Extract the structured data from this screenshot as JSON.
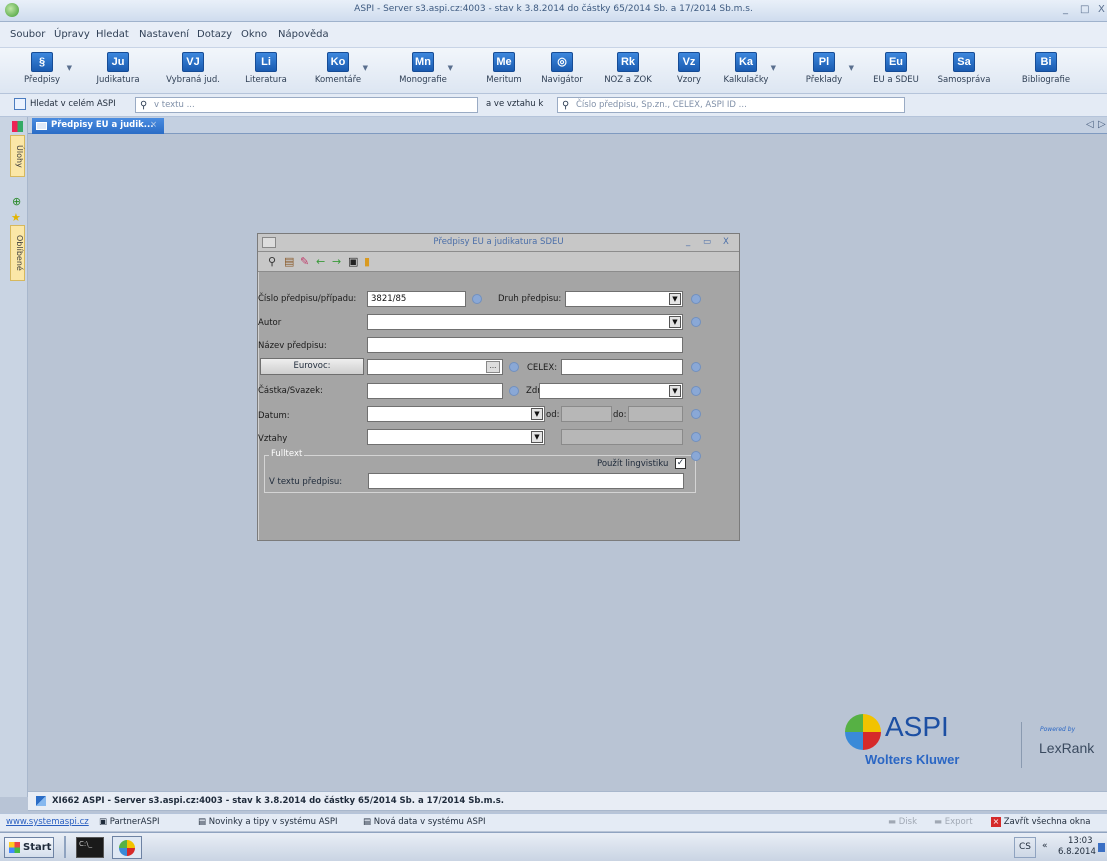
{
  "window": {
    "title": "ASPI - Server s3.aspi.cz:4003 - stav k 3.8.2014 do částky 65/2014 Sb. a 17/2014 Sb.m.s.",
    "controls": [
      "_",
      "□",
      "X"
    ]
  },
  "menu": [
    "Soubor",
    "Úpravy",
    "Hledat",
    "Nastavení",
    "Dotazy",
    "Okno",
    "Nápověda"
  ],
  "toolbar": [
    {
      "abbr": "§",
      "label": "Předpisy",
      "dropdown": true
    },
    {
      "abbr": "Ju",
      "label": "Judikatura",
      "dropdown": false
    },
    {
      "abbr": "VJ",
      "label": "Vybraná jud.",
      "dropdown": false
    },
    {
      "abbr": "Li",
      "label": "Literatura",
      "dropdown": false
    },
    {
      "abbr": "Ko",
      "label": "Komentáře",
      "dropdown": true
    },
    {
      "abbr": "Mn",
      "label": "Monografie",
      "dropdown": true
    },
    {
      "abbr": "Me",
      "label": "Meritum",
      "dropdown": false
    },
    {
      "abbr": "◎",
      "label": "Navigátor",
      "dropdown": false
    },
    {
      "abbr": "Rk",
      "label": "NOZ a ZOK",
      "dropdown": false
    },
    {
      "abbr": "Vz",
      "label": "Vzory",
      "dropdown": false
    },
    {
      "abbr": "Ka",
      "label": "Kalkulačky",
      "dropdown": true
    },
    {
      "abbr": "Pl",
      "label": "Překlady",
      "dropdown": true
    },
    {
      "abbr": "Eu",
      "label": "EU a SDEU",
      "dropdown": false
    },
    {
      "abbr": "Sa",
      "label": "Samospráva",
      "dropdown": false
    },
    {
      "abbr": "Bi",
      "label": "Bibliografie",
      "dropdown": false
    }
  ],
  "search": {
    "scope_label": "Hledat v celém ASPI",
    "text_placeholder": "v textu ...",
    "relation_label": "a ve vztahu k",
    "relation_placeholder": "Číslo předpisu, Sp.zn., CELEX, ASPI ID ..."
  },
  "sidebar": {
    "tasks": "Úlohy",
    "favorites": "Oblíbené"
  },
  "doc_tab": {
    "label": "Předpisy EU a judik..."
  },
  "dialog": {
    "title": "Předpisy EU a judikatura SDEU",
    "fields": {
      "cislo_label": "Číslo předpisu/případu:",
      "cislo_value": "3821/85",
      "druh_label": "Druh předpisu:",
      "autor_label": "Autor",
      "nazev_label": "Název předpisu:",
      "eurovoc_button": "Eurovoc:",
      "eurovoc_browse": "...",
      "celex_label": "CELEX:",
      "castka_label": "Částka/Svazek:",
      "zdroj_label": "Zdroj:",
      "datum_label": "Datum:",
      "od_label": "od:",
      "do_label": "do:",
      "vztahy_label": "Vztahy",
      "fulltext_legend": "Fulltext",
      "lingvistika_label": "Použít lingvistiku",
      "lingvistika_checked": true,
      "vtextu_label": "V textu předpisu:"
    }
  },
  "branding": {
    "name": "ASPI",
    "company": "Wolters Kluwer",
    "powered": "Powered by",
    "lexrank": "LexRank"
  },
  "status": {
    "text": "XI662 ASPI - Server s3.aspi.cz:4003 - stav k 3.8.2014 do částky 65/2014 Sb. a 17/2014 Sb.m.s."
  },
  "linkbar": {
    "site": "www.systemaspi.cz",
    "partner": "PartnerASPI",
    "news": "Novinky a tipy v systému ASPI",
    "newdata": "Nová data v systému ASPI",
    "disk": "Disk",
    "export": "Export",
    "close_all": "Zavřít všechna okna"
  },
  "taskbar": {
    "start": "Start",
    "lang": "CS",
    "time": "13:03",
    "date": "6.8.2014"
  }
}
